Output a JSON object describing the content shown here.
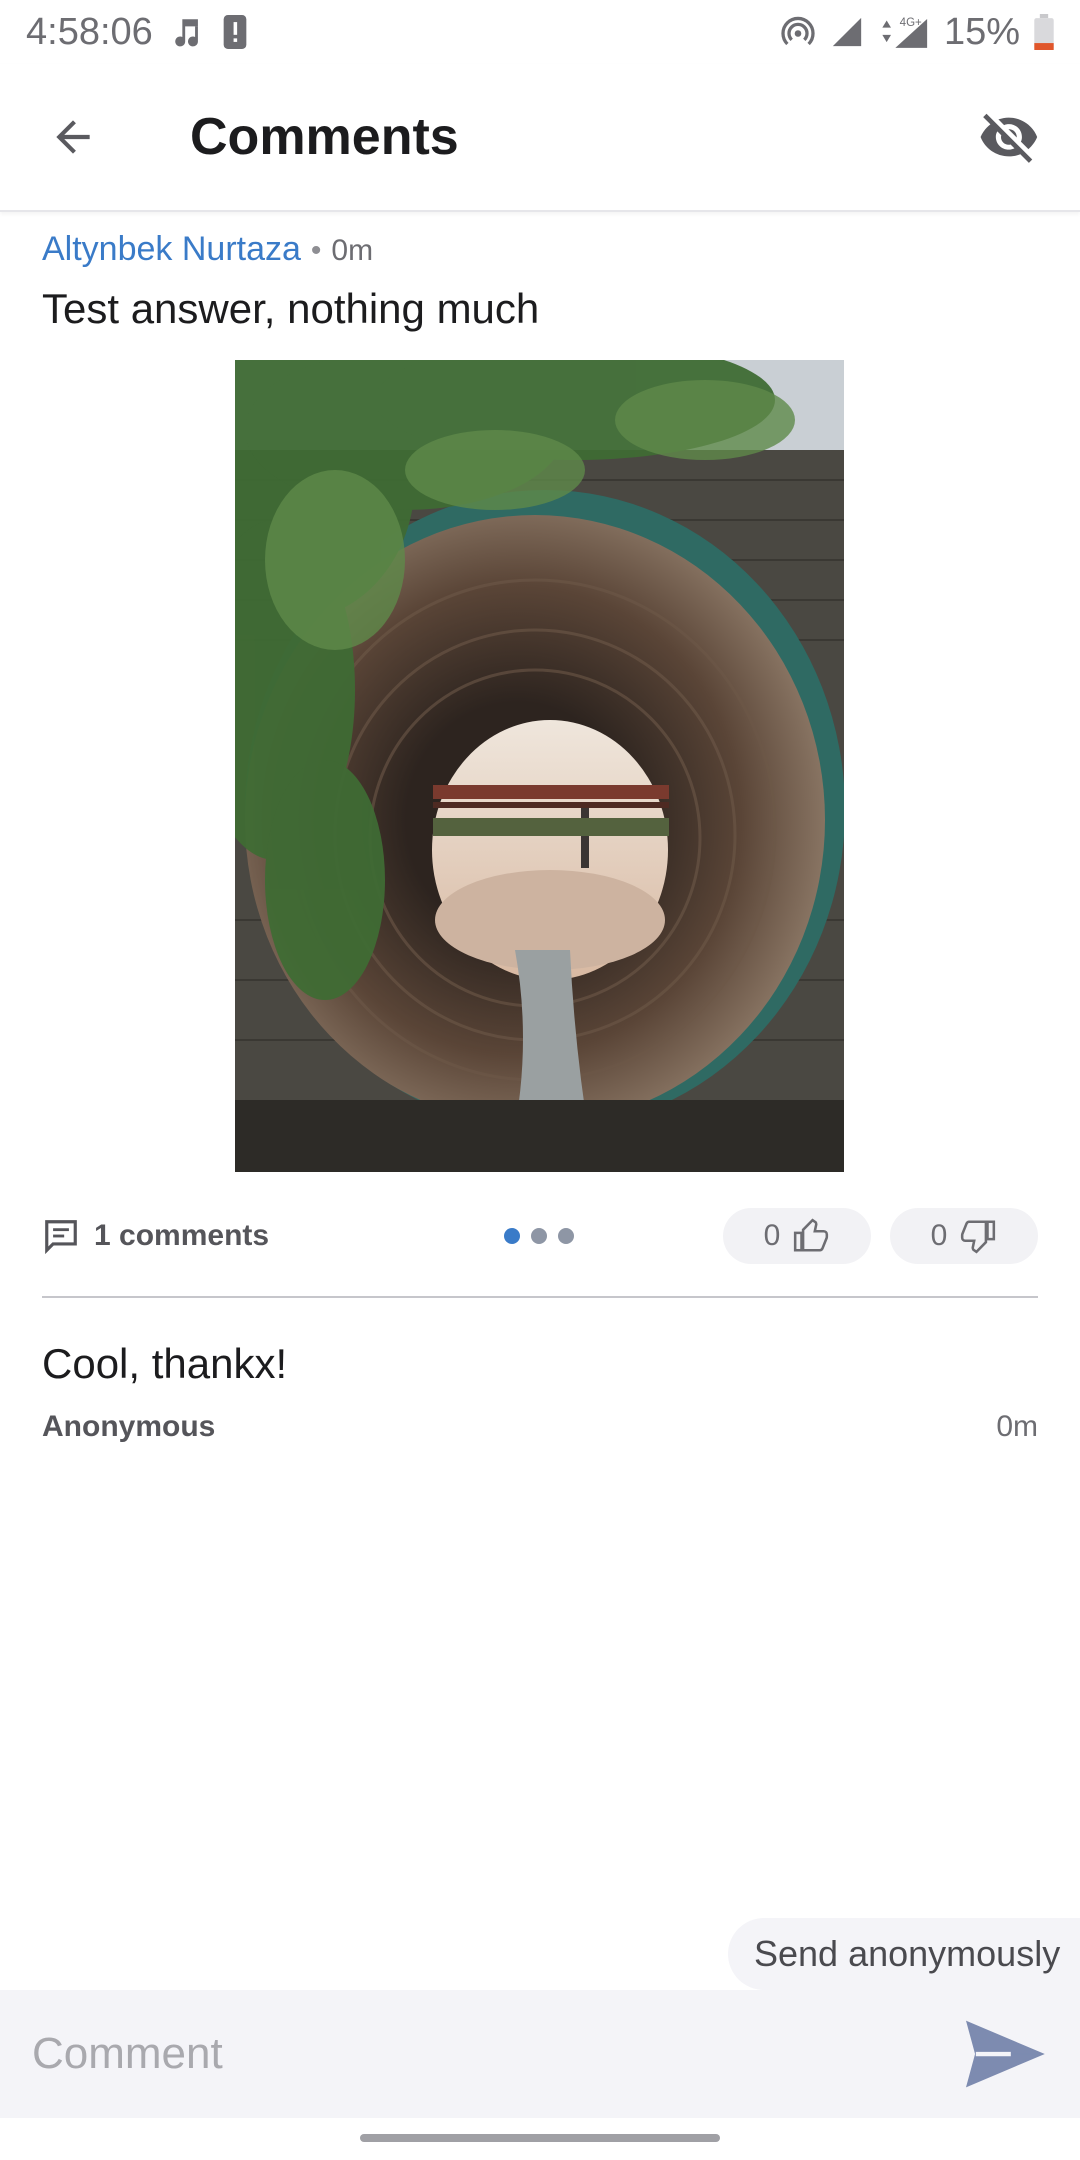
{
  "status_bar": {
    "time": "4:58:06",
    "battery": "15%",
    "network": "4G+",
    "icons": [
      "music-note-icon",
      "alert-icon",
      "hotspot-icon",
      "signal-icon",
      "data-arrows-icon",
      "battery-icon"
    ]
  },
  "app_bar": {
    "title": "Comments",
    "back_icon": "arrow-left-icon",
    "hide_icon": "eye-off-icon"
  },
  "post": {
    "author": "Altynbek Nurtaza",
    "separator": "•",
    "time": "0m",
    "text": "Test answer, nothing much",
    "image_alt": "Tunnel photo"
  },
  "actions": {
    "comments_label": "1 comments",
    "pager_total": 3,
    "pager_active": 0,
    "upvotes": "0",
    "downvotes": "0"
  },
  "comments": [
    {
      "text": "Cool, thankx!",
      "author": "Anonymous",
      "time": "0m"
    }
  ],
  "composer": {
    "anon_label": "Send anonymously",
    "placeholder": "Comment",
    "value": ""
  },
  "colors": {
    "accent": "#3a7bc8",
    "send": "#7d8bb0"
  }
}
